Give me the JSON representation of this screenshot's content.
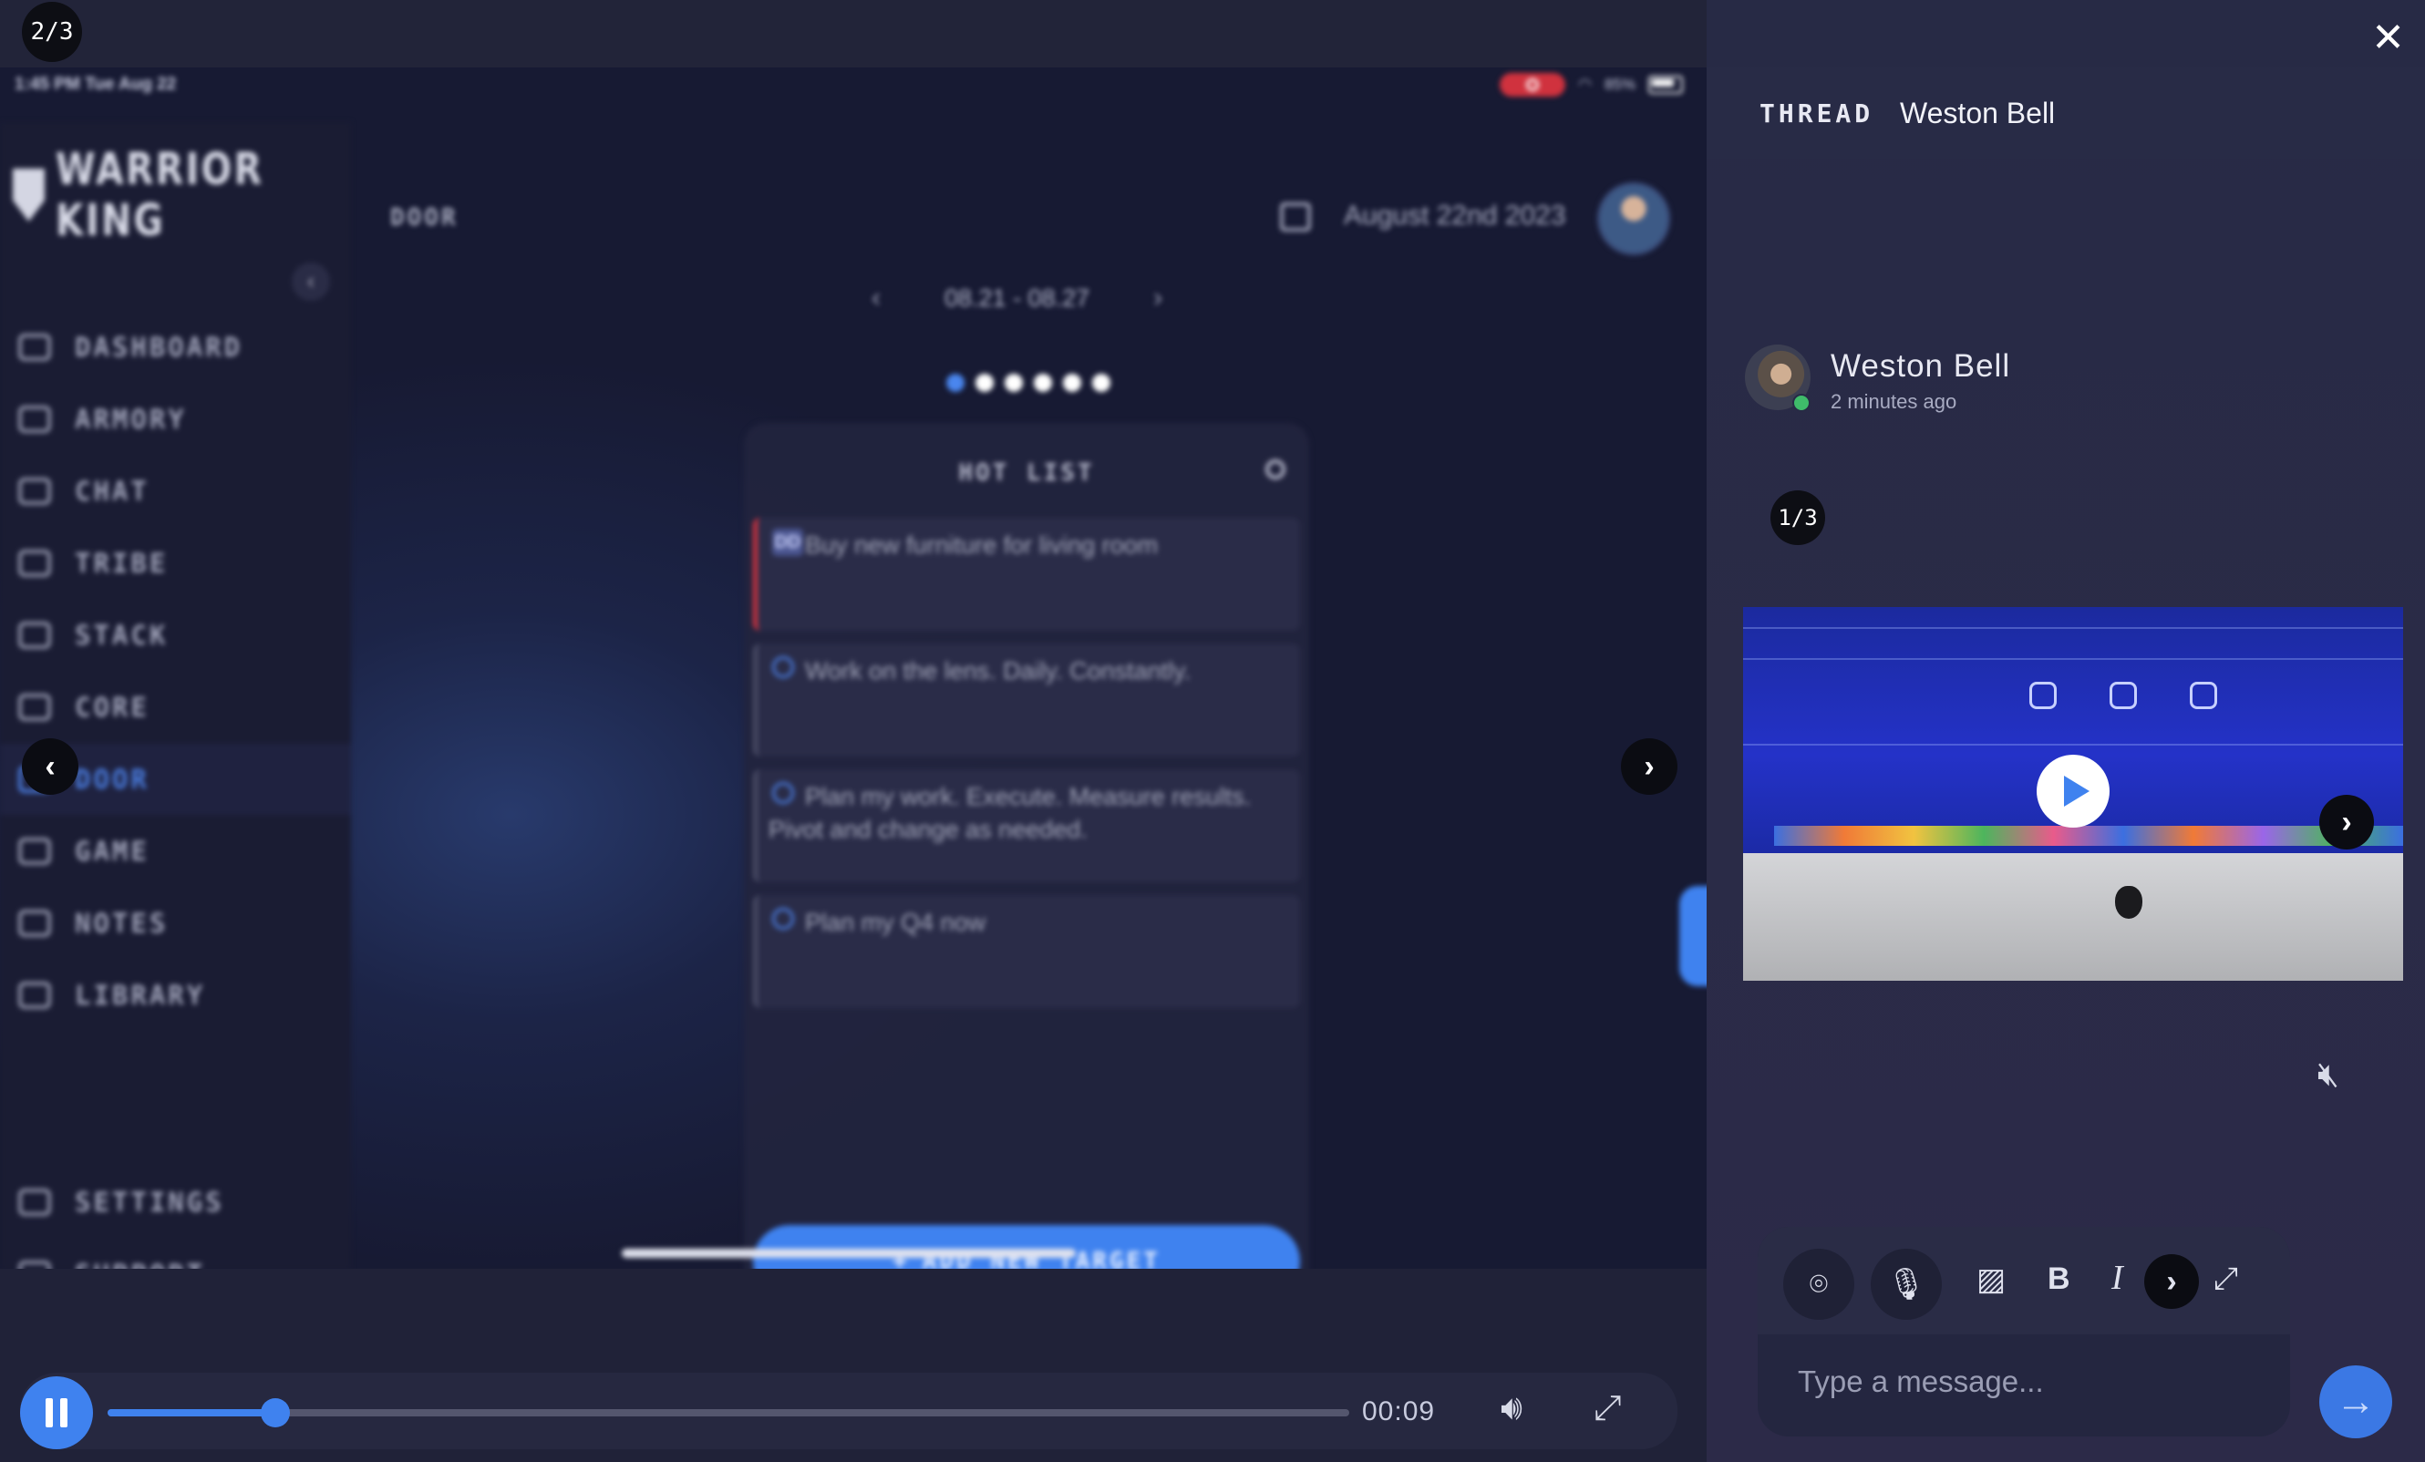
{
  "viewer": {
    "counter": "2/3",
    "status_time": "1:45 PM   Tue Aug 22",
    "battery": "85%",
    "brand": "WARRIOR KING",
    "crumb": "DOOR",
    "date": "August 22nd 2023",
    "week_range": "08.21 - 08.27",
    "nav": [
      {
        "label": "DASHBOARD"
      },
      {
        "label": "ARMORY"
      },
      {
        "label": "CHAT"
      },
      {
        "label": "TRIBE"
      },
      {
        "label": "STACK"
      },
      {
        "label": "CORE"
      },
      {
        "label": "DOOR",
        "active": true
      },
      {
        "label": "GAME"
      },
      {
        "label": "NOTES"
      },
      {
        "label": "LIBRARY"
      }
    ],
    "nav_bottom": [
      {
        "label": "SETTINGS"
      },
      {
        "label": "SUPPORT"
      }
    ],
    "hotlist": {
      "title": "HOT LIST",
      "tasks": [
        {
          "tag": "DD",
          "text": "Buy new furniture for living room"
        },
        {
          "text": "Work on the lens. Daily. Constantly."
        },
        {
          "text": "Plan my work. Execute. Measure results. Pivot and change as needed."
        },
        {
          "text": "Plan my Q4 now"
        }
      ],
      "add_label": "ADD NEW TARGET"
    },
    "player": {
      "time": "00:09",
      "progress": 0.135
    }
  },
  "thread": {
    "label": "THREAD",
    "user": "Weston Bell",
    "author": "Weston Bell",
    "posted": "2 minutes ago",
    "media_counter": "1/3",
    "composer": {
      "placeholder": "Type a message..."
    }
  },
  "colors": {
    "accent": "#3f82ef",
    "alert": "#d3333f",
    "online": "#3fbb6a"
  }
}
